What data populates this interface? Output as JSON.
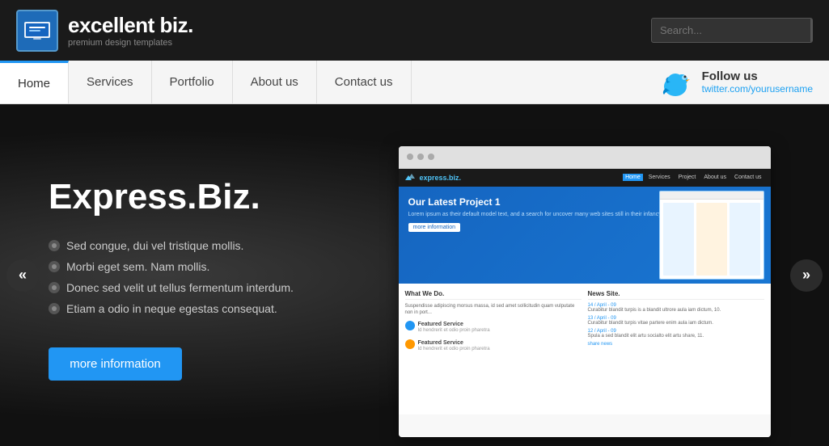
{
  "header": {
    "logo_title": "excellent biz.",
    "logo_subtitle": "premium design templates",
    "search_placeholder": "Search..."
  },
  "nav": {
    "items": [
      {
        "label": "Home",
        "active": true
      },
      {
        "label": "Services",
        "active": false
      },
      {
        "label": "Portfolio",
        "active": false
      },
      {
        "label": "About us",
        "active": false
      },
      {
        "label": "Contact us",
        "active": false
      }
    ],
    "follow_label": "Follow us",
    "twitter_link": "twitter.com/yourusername"
  },
  "slide": {
    "title": "Express.Biz.",
    "bullets": [
      "Sed congue, dui vel tristique mollis.",
      "Morbi eget sem. Nam mollis.",
      "Donec sed velit ut tellus fermentum interdum.",
      "Etiam a odio in neque egestas consequat."
    ],
    "cta_label": "more information"
  },
  "inner_mockup": {
    "logo": "express.biz.",
    "nav_items": [
      "Home",
      "Services",
      "Project",
      "About us",
      "Contact us"
    ],
    "hero_title": "Our Latest Project 1",
    "hero_text": "Lorem ipsum as their default model text, and a search for uncover many web sites still in their infancy.",
    "hero_btn": "more information",
    "sections": [
      {
        "title": "What We Do.",
        "services": [
          {
            "text": "Suspendisse adipiscing morsus massa, id sed amet sollicitudin quam vulputate non in port..."
          },
          {
            "text": "Featured Service"
          },
          {
            "text": "Featured Service"
          }
        ]
      },
      {
        "title": "News Site.",
        "items": [
          {
            "date": "14 / April - 09",
            "text": "Curabitur blandit turpis is a blandit ultrore aula iam dictum, 10."
          },
          {
            "date": "13 / April - 09",
            "text": "Curabitur blandit turpis vitae partere enim aula iam dictum."
          },
          {
            "date": "12 / April - 09",
            "text": "Spula a sed blandit elit artu socialto elit artu share, 11."
          },
          {
            "date": "share news",
            "text": ""
          }
        ]
      }
    ]
  },
  "arrows": {
    "left": "«",
    "right": "»"
  }
}
